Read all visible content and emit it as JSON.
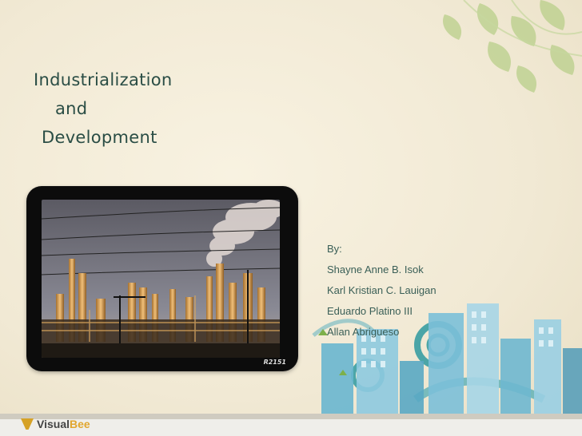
{
  "slide": {
    "title_lines": [
      "Industrialization",
      "and",
      "Development"
    ],
    "byline_label": "By:",
    "authors": [
      "Shayne Anne B. Isok",
      "Karl Kristian C. Lauigan",
      "Eduardo Platino III",
      "Allan Abrigueso"
    ],
    "photo_credit": "R2151"
  },
  "footer": {
    "logo_text_primary": "Visual",
    "logo_text_accent": "Bee"
  },
  "colors": {
    "title": "#2a4d45",
    "authors": "#3a5f57",
    "background": "#f3ecd9"
  },
  "icons": [
    "leaf-decoration",
    "city-skyline-decoration",
    "swirl-decoration"
  ]
}
